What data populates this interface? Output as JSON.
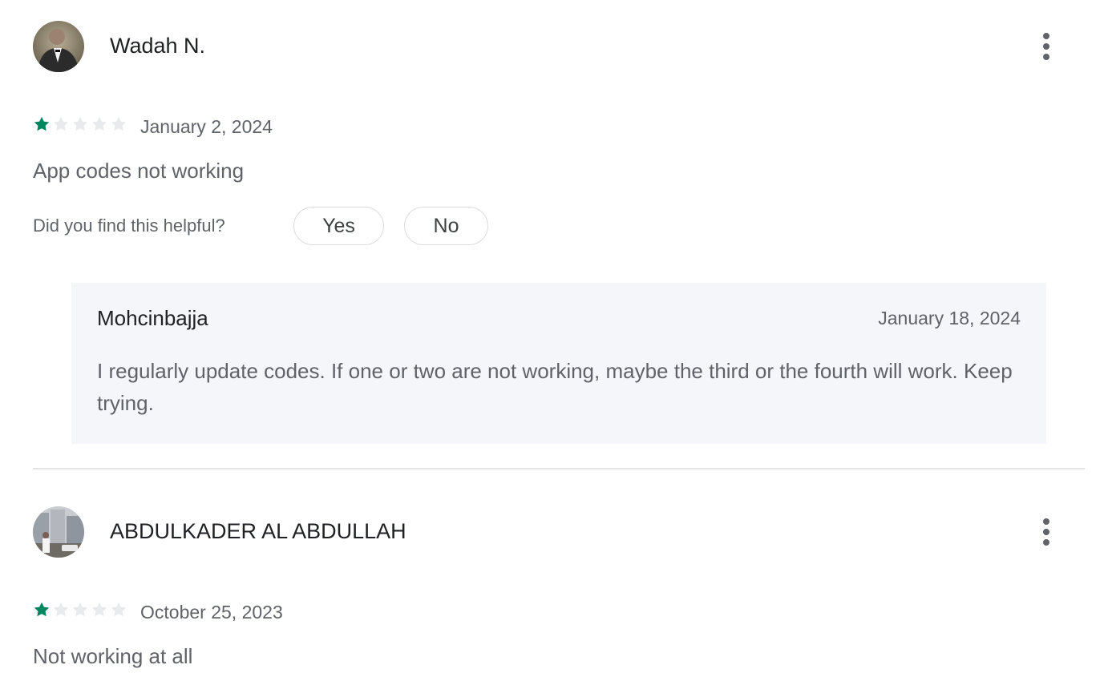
{
  "reviews": [
    {
      "author": "Wadah N.",
      "rating": 1,
      "max_rating": 5,
      "date": "January 2, 2024",
      "text": "App codes not working",
      "helpful_question": "Did you find this helpful?",
      "yes_label": "Yes",
      "no_label": "No",
      "reply": {
        "author": "Mohcinbajja",
        "date": "January 18, 2024",
        "text": "I regularly update codes. If one or two are not working, maybe the third or the fourth will work. Keep trying."
      }
    },
    {
      "author": "ABDULKADER AL ABDULLAH",
      "rating": 1,
      "max_rating": 5,
      "date": "October 25, 2023",
      "text": "Not working at all"
    }
  ],
  "icons": {
    "more": "more-vert-icon",
    "star_filled": "star-filled-icon",
    "star_empty": "star-empty-icon"
  },
  "colors": {
    "star_filled": "#01875f",
    "star_empty": "#e8eaed",
    "reply_bg": "#f5f6f9"
  }
}
